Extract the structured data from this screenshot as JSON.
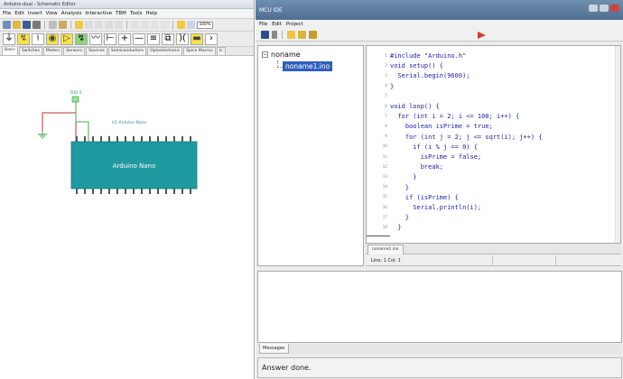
{
  "schematic": {
    "title": "Arduino-dual - Schematic Editor",
    "menu": [
      "File",
      "Edit",
      "Insert",
      "View",
      "Analysis",
      "Interactive",
      "TBM",
      "Tools",
      "Help"
    ],
    "zoom": "100%",
    "component_tabs": [
      "Basic",
      "Switches",
      "Meters",
      "Sensors",
      "Sources",
      "Semiconductors",
      "Optoelectronic",
      "Spice Macros",
      "Ic"
    ],
    "labels": {
      "dio": "DIO 5",
      "part": "U1 Arduino Nano",
      "chip": "Arduino Nano"
    },
    "colors": {
      "chip": "#1e9aa0",
      "wire_green": "#4aa84a",
      "wire_red": "#c03030"
    }
  },
  "ide": {
    "title": "MCU IDE",
    "menu": [
      "File",
      "Edit",
      "Project"
    ],
    "project_root": "noname",
    "project_file": "noname1.ino",
    "code_lines": [
      {
        "n": "1",
        "text": "#include \"Arduino.h\""
      },
      {
        "n": "2",
        "text": "void setup() {"
      },
      {
        "n": "3",
        "text": "  Serial.begin(9600);"
      },
      {
        "n": "4",
        "text": "}"
      },
      {
        "n": "5",
        "text": ""
      },
      {
        "n": "6",
        "text": "void loop() {"
      },
      {
        "n": "7",
        "text": "  for (int i = 2; i <= 100; i++) {"
      },
      {
        "n": "8",
        "text": "    boolean isPrime = true;"
      },
      {
        "n": "9",
        "text": "    for (int j = 2; j <= sqrt(i); j++) {"
      },
      {
        "n": "10",
        "text": "      if (i % j == 0) {"
      },
      {
        "n": "11",
        "text": "        isPrime = false;"
      },
      {
        "n": "12",
        "text": "        break;"
      },
      {
        "n": "13",
        "text": "      }"
      },
      {
        "n": "14",
        "text": "    }"
      },
      {
        "n": "15",
        "text": "    if (isPrime) {"
      },
      {
        "n": "16",
        "text": "      Serial.println(i);"
      },
      {
        "n": "17",
        "text": "    }"
      },
      {
        "n": "18",
        "text": "  }"
      }
    ],
    "file_tab": "noname1.ino",
    "status": "Line: 1  Col: 1",
    "messages_tab": "Messages",
    "answer": "Answer done.",
    "colors": {
      "code": "#1f22b0",
      "selection": "#2f5fbf",
      "titlebar": "#5a7a9c"
    }
  }
}
